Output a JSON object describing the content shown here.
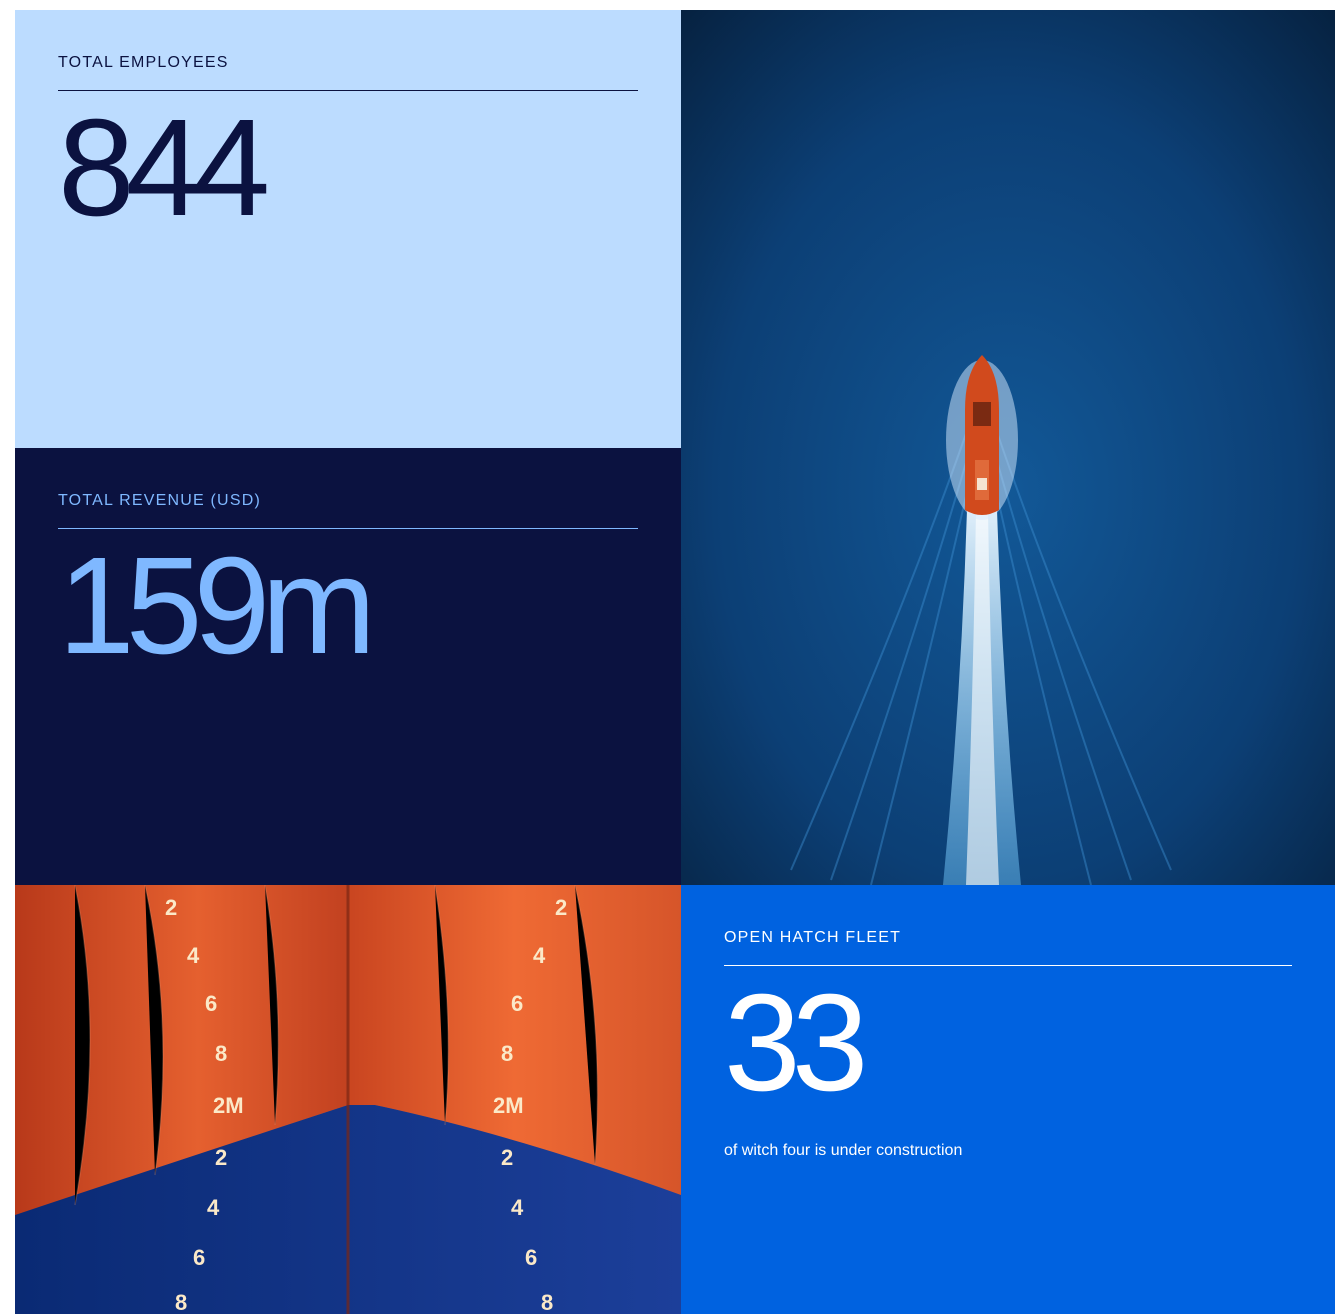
{
  "stats": {
    "employees": {
      "label": "TOTAL EMPLOYEES",
      "value": "844"
    },
    "revenue": {
      "label": "TOTAL REVENUE (USD)",
      "value": "159m"
    },
    "fleet": {
      "label": "OPEN HATCH FLEET",
      "value": "33",
      "note": "of witch four is under construction"
    }
  },
  "hull_photo": {
    "draft_marks": [
      "2",
      "4",
      "6",
      "8",
      "2M",
      "2",
      "4",
      "6",
      "8"
    ]
  },
  "colors": {
    "light_blue": "#bcdcff",
    "navy": "#0b1240",
    "accent_blue": "#7fb8ff",
    "brand_blue": "#0062e0",
    "hull_orange": "#d8481a"
  }
}
